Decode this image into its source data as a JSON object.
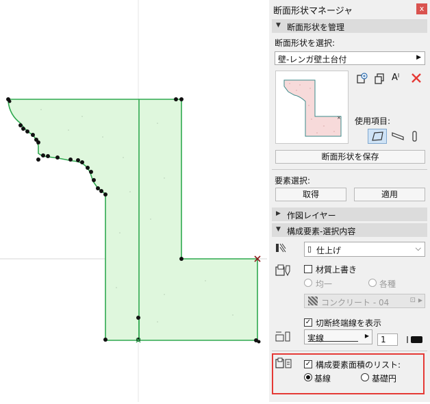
{
  "panel": {
    "title": "断面形状マネージャ",
    "close_label": "x",
    "section_manage": "断面形状を管理",
    "select_label": "断面形状を選択:",
    "selected_profile": "壁-レンガ壁土台付",
    "usage_label": "使用項目:",
    "save_button": "断面形状を保存",
    "element_select_label": "要素選択:",
    "get_button": "取得",
    "apply_button": "適用",
    "section_layers": "作図レイヤー",
    "section_components": "構成要素-選択内容",
    "finish_value": "仕上げ",
    "override_material": "材質上書き",
    "radio_uniform": "均一",
    "radio_various": "各種",
    "material_value": "コンクリート - 04",
    "show_cut_end_lines": "切断終端線を表示",
    "line_type": "実線",
    "pen_number": "1",
    "list_component_areas": "構成要素面積のリスト:",
    "radio_base_line": "基線",
    "radio_base_circle": "基礎円"
  },
  "colors": {
    "fill": "#dff7dd",
    "edge": "#2fa84f",
    "highlight_box": "#e53935",
    "delete": "#e53935"
  }
}
